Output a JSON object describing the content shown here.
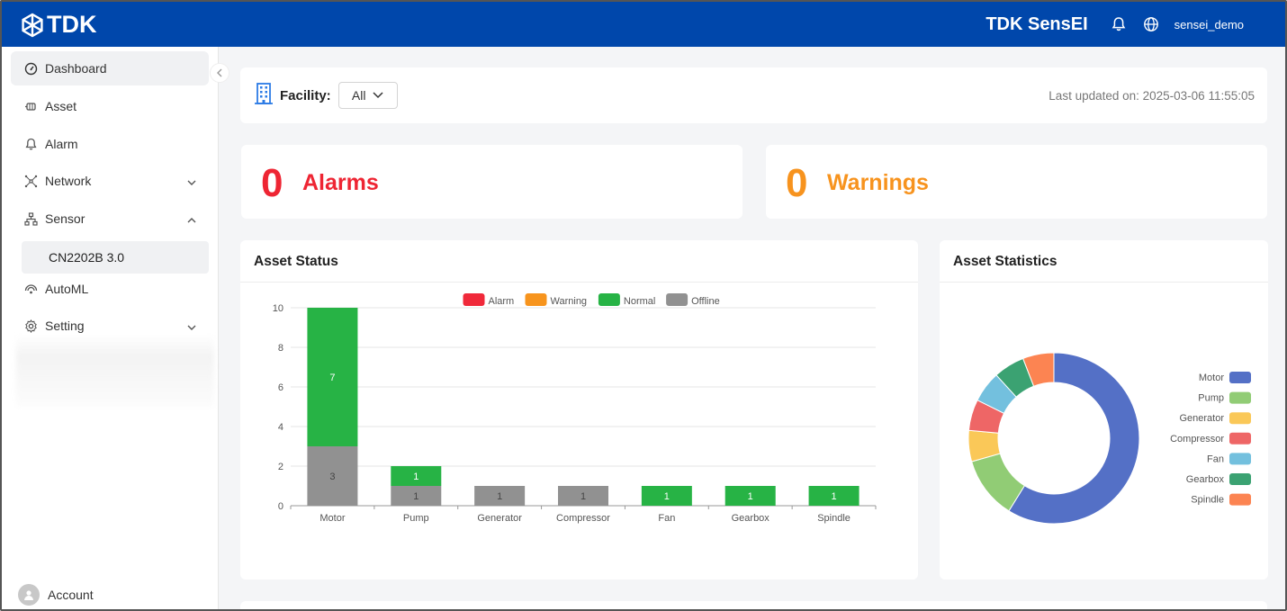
{
  "header": {
    "logo_text": "TDK",
    "app_name": "TDK SensEI",
    "username": "sensei_demo",
    "bg_color": "#0047ab"
  },
  "sidebar": {
    "items": [
      {
        "label": "Dashboard",
        "icon": "dashboard-icon"
      },
      {
        "label": "Asset",
        "icon": "asset-icon"
      },
      {
        "label": "Alarm",
        "icon": "bell-icon"
      },
      {
        "label": "Network",
        "icon": "network-icon"
      },
      {
        "label": "Sensor",
        "icon": "sensor-icon"
      },
      {
        "label": "AutoML",
        "icon": "automl-icon"
      },
      {
        "label": "Setting",
        "icon": "gear-icon"
      }
    ],
    "sub_item": "CN2202B 3.0",
    "account_label": "Account"
  },
  "facility": {
    "label": "Facility:",
    "selected": "All",
    "last_updated": "Last updated on: 2025-03-06 11:55:05"
  },
  "alarms": {
    "count": "0",
    "label": "Alarms",
    "color": "#ee2533"
  },
  "warnings": {
    "count": "0",
    "label": "Warnings",
    "color": "#f7931e"
  },
  "asset_status": {
    "title": "Asset Status"
  },
  "asset_statistics": {
    "title": "Asset Statistics"
  },
  "chart_data": [
    {
      "type": "bar",
      "stacked": true,
      "title": "Asset Status",
      "categories": [
        "Motor",
        "Pump",
        "Generator",
        "Compressor",
        "Fan",
        "Gearbox",
        "Spindle"
      ],
      "series": [
        {
          "name": "Alarm",
          "color": "#f0293a",
          "values": [
            0,
            0,
            0,
            0,
            0,
            0,
            0
          ]
        },
        {
          "name": "Warning",
          "color": "#f7941d",
          "values": [
            0,
            0,
            0,
            0,
            0,
            0,
            0
          ]
        },
        {
          "name": "Normal",
          "color": "#27b345",
          "values": [
            7,
            1,
            0,
            0,
            1,
            1,
            1
          ]
        },
        {
          "name": "Offline",
          "color": "#919191",
          "values": [
            3,
            1,
            1,
            1,
            0,
            0,
            0
          ]
        }
      ],
      "ylim": [
        0,
        10
      ],
      "yticks": [
        0,
        2,
        4,
        6,
        8,
        10
      ],
      "grid": true,
      "legend": "top"
    },
    {
      "type": "pie",
      "donut": true,
      "title": "Asset Statistics",
      "labels": [
        "Motor",
        "Pump",
        "Generator",
        "Compressor",
        "Fan",
        "Gearbox",
        "Spindle"
      ],
      "values": [
        10,
        2,
        1,
        1,
        1,
        1,
        1
      ],
      "colors": [
        "#5470c6",
        "#91cc75",
        "#fac858",
        "#ee6666",
        "#73c0de",
        "#3ba272",
        "#fc8452"
      ],
      "legend": "right"
    }
  ]
}
